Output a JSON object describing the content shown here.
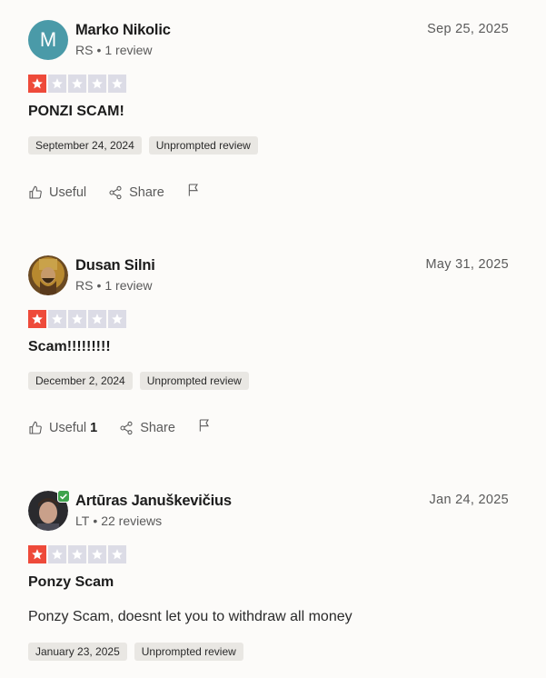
{
  "reviews": [
    {
      "name": "Marko Nikolic",
      "avatar_letter": "M",
      "country": "RS",
      "count": "1 review",
      "date": "Sep 25, 2025",
      "rating": 1,
      "title": "PONZI SCAM!",
      "text": "",
      "experience_date": "September 24, 2024",
      "tag": "Unprompted review",
      "useful_label": "Useful",
      "useful_count": "",
      "share_label": "Share"
    },
    {
      "name": "Dusan Silni",
      "country": "RS",
      "count": "1 review",
      "date": "May 31, 2025",
      "rating": 1,
      "title": "Scam!!!!!!!!!",
      "text": "",
      "experience_date": "December 2, 2024",
      "tag": "Unprompted review",
      "useful_label": "Useful",
      "useful_count": "1",
      "share_label": "Share"
    },
    {
      "name": "Artūras Januškevičius",
      "country": "LT",
      "count": "22 reviews",
      "date": "Jan 24, 2025",
      "rating": 1,
      "title": "Ponzy Scam",
      "text": "Ponzy Scam, doesnt let you to withdraw all money",
      "experience_date": "January 23, 2025",
      "tag": "Unprompted review"
    }
  ],
  "colors": {
    "star_on": "#ee4a3a",
    "star_off": "#dcdce6",
    "avatar_teal": "#4a9aa8",
    "verified_green": "#3fa34d"
  }
}
